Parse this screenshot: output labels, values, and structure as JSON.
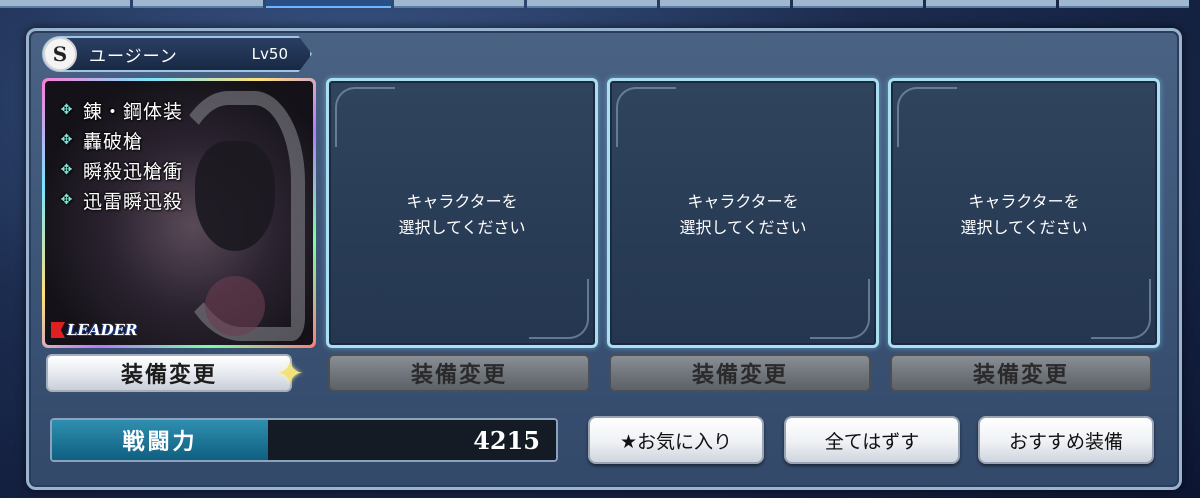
{
  "character": {
    "name": "ユージーン",
    "level": "Lv50",
    "emblem": "S",
    "skills": [
      "錬・鋼体装",
      "轟破槍",
      "瞬殺迅槍衝",
      "迅雷瞬迅殺"
    ],
    "skill_icon": "diamond-cross-icon",
    "leader_label": "LEADER"
  },
  "slots": [
    {
      "prompt": "キャラクターを\n選択してください"
    },
    {
      "prompt": "キャラクターを\n選択してください"
    },
    {
      "prompt": "キャラクターを\n選択してください"
    }
  ],
  "equip_buttons": [
    {
      "label": "装備変更",
      "state": "active"
    },
    {
      "label": "装備変更",
      "state": "disabled"
    },
    {
      "label": "装備変更",
      "state": "disabled"
    },
    {
      "label": "装備変更",
      "state": "disabled"
    }
  ],
  "combat_power": {
    "label": "戦闘力",
    "value": "4215"
  },
  "actions": {
    "favorite": "★お気に入り",
    "remove_all": "全てはずす",
    "recommended": "おすすめ装備"
  },
  "colors": {
    "panel": "#3b5375",
    "slot_border": "#a9dff0",
    "power_label": "#1f7fa0",
    "skill_icon": "#7fe9d8"
  }
}
